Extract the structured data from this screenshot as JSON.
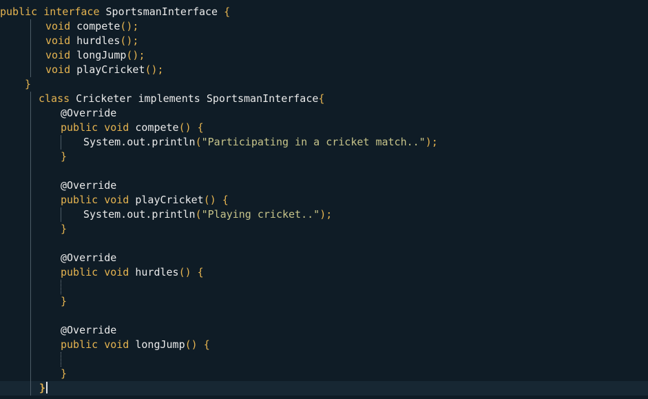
{
  "editor": {
    "colors": {
      "background": "#0f1c26",
      "keyword": "#e6b450",
      "identifier": "#eaeaea",
      "string": "#c7c48a",
      "current_line": "#172733"
    },
    "lines": [
      [
        {
          "t": "public",
          "c": "kw"
        },
        {
          "t": " "
        },
        {
          "t": "interface",
          "c": "kw"
        },
        {
          "t": " SportsmanInterface ",
          "c": "id"
        },
        {
          "t": "{",
          "c": "pn"
        }
      ],
      [
        {
          "t": "void",
          "c": "kw"
        },
        {
          "t": " compete",
          "c": "id"
        },
        {
          "t": "();",
          "c": "pn"
        }
      ],
      [
        {
          "t": "void",
          "c": "kw"
        },
        {
          "t": " hurdles",
          "c": "id"
        },
        {
          "t": "();",
          "c": "pn"
        }
      ],
      [
        {
          "t": "void",
          "c": "kw"
        },
        {
          "t": " longJump",
          "c": "id"
        },
        {
          "t": "();",
          "c": "pn"
        }
      ],
      [
        {
          "t": "void",
          "c": "kw"
        },
        {
          "t": " playCricket",
          "c": "id"
        },
        {
          "t": "();",
          "c": "pn"
        }
      ],
      [
        {
          "t": "}",
          "c": "pn"
        }
      ],
      [
        {
          "t": "class",
          "c": "kw"
        },
        {
          "t": " Cricketer implements SportsmanInterface",
          "c": "id"
        },
        {
          "t": "{",
          "c": "pn"
        }
      ],
      [
        {
          "t": "@Override",
          "c": "an"
        }
      ],
      [
        {
          "t": "public",
          "c": "kw"
        },
        {
          "t": " "
        },
        {
          "t": "void",
          "c": "kw"
        },
        {
          "t": " compete",
          "c": "id"
        },
        {
          "t": "() {",
          "c": "pn"
        }
      ],
      [
        {
          "t": "System.out.println",
          "c": "id"
        },
        {
          "t": "(",
          "c": "pn"
        },
        {
          "t": "\"Participating in a cricket match..\"",
          "c": "st"
        },
        {
          "t": ");",
          "c": "pn"
        }
      ],
      [
        {
          "t": "}",
          "c": "pn"
        }
      ],
      [],
      [
        {
          "t": "@Override",
          "c": "an"
        }
      ],
      [
        {
          "t": "public",
          "c": "kw"
        },
        {
          "t": " "
        },
        {
          "t": "void",
          "c": "kw"
        },
        {
          "t": " playCricket",
          "c": "id"
        },
        {
          "t": "() {",
          "c": "pn"
        }
      ],
      [
        {
          "t": "System.out.println",
          "c": "id"
        },
        {
          "t": "(",
          "c": "pn"
        },
        {
          "t": "\"Playing cricket..\"",
          "c": "st"
        },
        {
          "t": ");",
          "c": "pn"
        }
      ],
      [
        {
          "t": "}",
          "c": "pn"
        }
      ],
      [],
      [
        {
          "t": "@Override",
          "c": "an"
        }
      ],
      [
        {
          "t": "public",
          "c": "kw"
        },
        {
          "t": " "
        },
        {
          "t": "void",
          "c": "kw"
        },
        {
          "t": " hurdles",
          "c": "id"
        },
        {
          "t": "() {",
          "c": "pn"
        }
      ],
      [],
      [
        {
          "t": "}",
          "c": "pn"
        }
      ],
      [],
      [
        {
          "t": "@Override",
          "c": "an"
        }
      ],
      [
        {
          "t": "public",
          "c": "kw"
        },
        {
          "t": " "
        },
        {
          "t": "void",
          "c": "kw"
        },
        {
          "t": " longJump",
          "c": "id"
        },
        {
          "t": "() {",
          "c": "pn"
        }
      ],
      [],
      [
        {
          "t": "}",
          "c": "pn"
        }
      ],
      [
        {
          "t": "}",
          "c": "brace-match",
          "caret": true
        }
      ]
    ]
  }
}
